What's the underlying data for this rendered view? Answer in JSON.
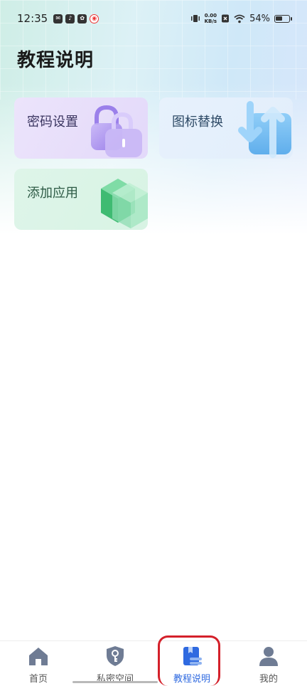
{
  "status_bar": {
    "time": "12:35",
    "net_speed_value": "0.00",
    "net_speed_unit": "KB/s",
    "battery_percent": "54%",
    "battery_level": 0.54,
    "app_icons": [
      "mail-icon",
      "tiktok-icon",
      "app-icon",
      "weibo-icon"
    ]
  },
  "page": {
    "title": "教程说明"
  },
  "cards": {
    "password": {
      "label": "密码设置",
      "icon": "lock-icon",
      "color": "#a88ef0"
    },
    "icon_change": {
      "label": "图标替换",
      "icon": "swap-arrows-icon",
      "color": "#5fb3f0"
    },
    "add_app": {
      "label": "添加应用",
      "icon": "cube-icon",
      "color": "#4cc27e"
    }
  },
  "bottom_nav": {
    "items": [
      {
        "label": "首页",
        "icon": "home-icon"
      },
      {
        "label": "私密空间",
        "icon": "shield-key-icon"
      },
      {
        "label": "教程说明",
        "icon": "book-icon",
        "active": true
      },
      {
        "label": "我的",
        "icon": "person-icon"
      }
    ],
    "active_color": "#2f6ae0",
    "highlight_color": "#d4202a"
  }
}
